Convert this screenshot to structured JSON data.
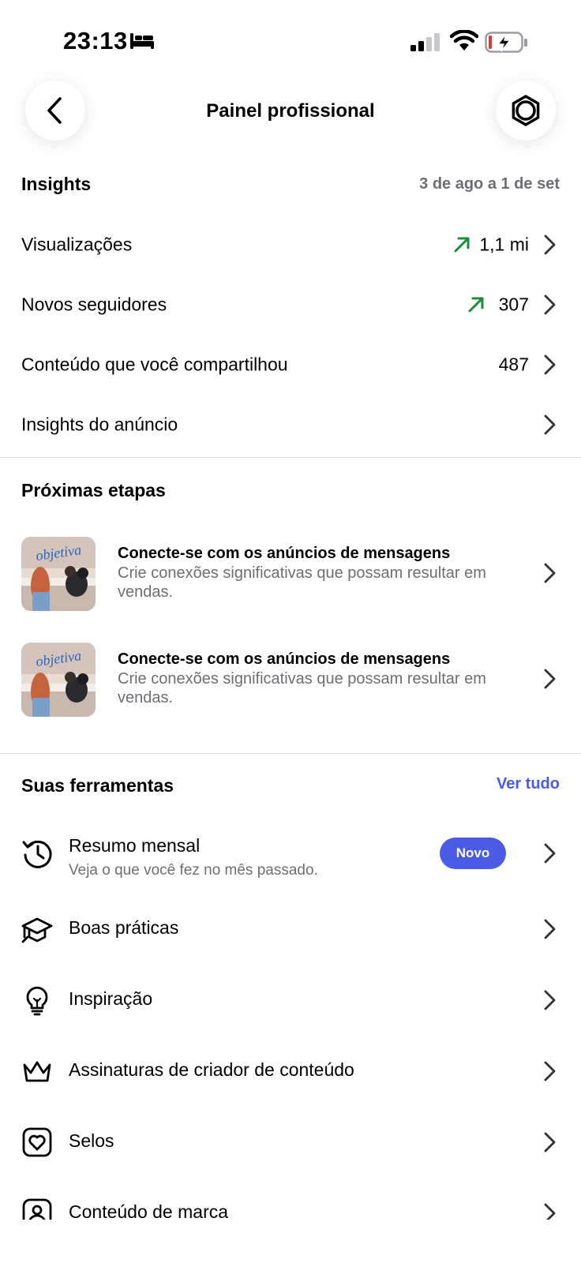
{
  "status_bar": {
    "time": "23:13"
  },
  "header": {
    "title": "Painel profissional"
  },
  "insights": {
    "title": "Insights",
    "date_range": "3 de ago a 1 de set",
    "rows": [
      {
        "label": "Visualizações",
        "value": "1,1 mi",
        "trend": "up"
      },
      {
        "label": "Novos seguidores",
        "value": "307",
        "trend": "up"
      },
      {
        "label": "Conteúdo que você compartilhou",
        "value": "487"
      },
      {
        "label": "Insights do anúncio",
        "value": ""
      }
    ]
  },
  "next_steps": {
    "title": "Próximas etapas",
    "items": [
      {
        "title": "Conecte-se com os anúncios de mensagens",
        "desc": "Crie conexões significativas que possam resultar em vendas.",
        "thumb_text": "objetiva"
      },
      {
        "title": "Conecte-se com os anúncios de mensagens",
        "desc": "Crie conexões significativas que possam resultar em vendas.",
        "thumb_text": "objetiva"
      }
    ]
  },
  "tools": {
    "title": "Suas ferramentas",
    "see_all": "Ver tudo",
    "items": [
      {
        "label": "Resumo mensal",
        "sub": "Veja o que você fez no mês passado.",
        "badge": "Novo",
        "icon": "history-icon"
      },
      {
        "label": "Boas práticas",
        "icon": "graduation-cap-icon"
      },
      {
        "label": "Inspiração",
        "icon": "lightbulb-icon"
      },
      {
        "label": "Assinaturas de criador de conteúdo",
        "icon": "crown-icon"
      },
      {
        "label": "Selos",
        "icon": "heart-badge-icon"
      },
      {
        "label": "Conteúdo de marca",
        "icon": "branded-content-icon"
      }
    ]
  },
  "colors": {
    "accent": "#4a5ce6",
    "trend_up": "#1f8a3b",
    "muted": "#6e6e73"
  }
}
